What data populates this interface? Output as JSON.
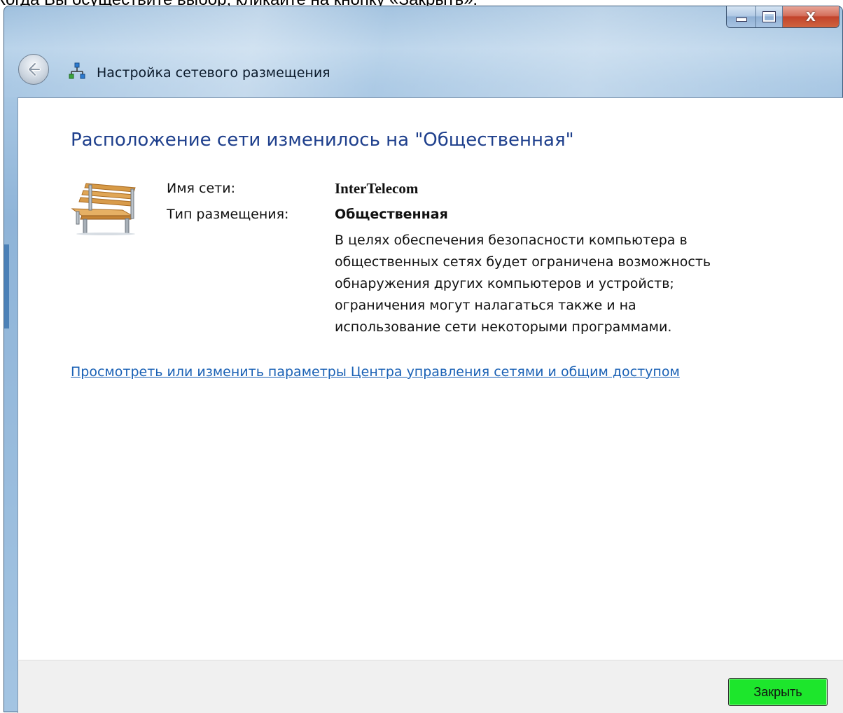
{
  "page": {
    "top_caption": "Когда Вы осуществите выбор, кликайте на кнопку «Закрыть»."
  },
  "window": {
    "title": "Настройка сетевого размещения",
    "controls": {
      "minimize": "minimize-icon",
      "maximize": "maximize-icon",
      "close": "close-icon",
      "close_glyph": "X"
    }
  },
  "main": {
    "heading": "Расположение сети изменилось на \"Общественная\"",
    "network_name_label": "Имя сети:",
    "network_name_value": "InterTelecom",
    "location_type_label": "Тип размещения:",
    "location_type_value": "Общественная",
    "description_lines": [
      "В целях обеспечения безопасности компьютера в",
      "общественных сетях будет ограничена возможность",
      "обнаружения других компьютеров и устройств;",
      "ограничения могут налагаться также и на",
      "использование сети некоторыми программами."
    ],
    "settings_link": "Просмотреть или изменить параметры Центра управления сетями и общим доступом"
  },
  "footer": {
    "close_button": "Закрыть"
  },
  "colors": {
    "heading": "#1e3f8c",
    "link": "#1a61b5",
    "close_button_bg": "#1de62c",
    "window_frame": "#a3c4e2"
  },
  "icons": {
    "back": "back-arrow-icon",
    "network": "network-icon",
    "location": "park-bench-icon"
  }
}
